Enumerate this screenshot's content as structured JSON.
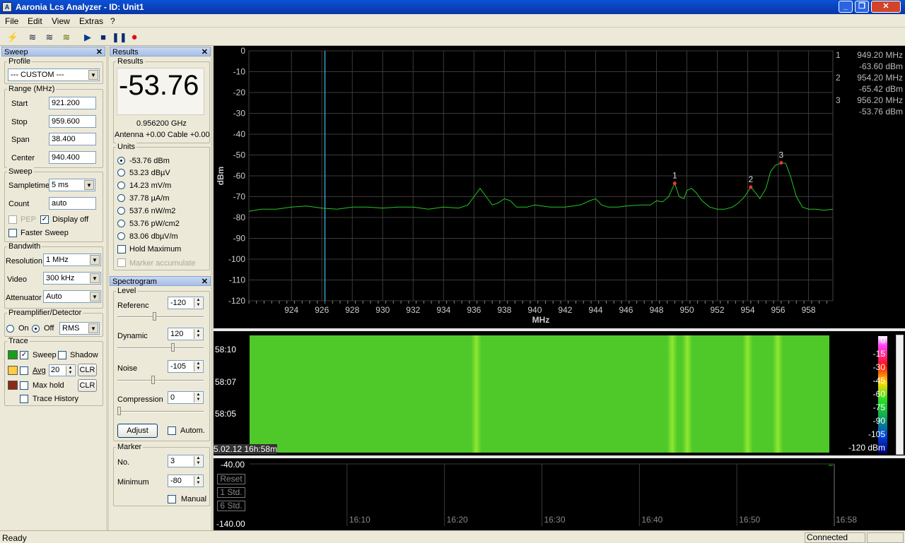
{
  "window": {
    "title": "Aaronia Lcs Analyzer - ID: Unit1"
  },
  "menu": [
    "File",
    "Edit",
    "View",
    "Extras",
    "?"
  ],
  "sweep_panel": {
    "title": "Sweep",
    "profile_label": "Profile",
    "profile_value": "--- CUSTOM ---",
    "range_label": "Range (MHz)",
    "start_label": "Start",
    "start_value": "921.200",
    "stop_label": "Stop",
    "stop_value": "959.600",
    "span_label": "Span",
    "span_value": "38.400",
    "center_label": "Center",
    "center_value": "940.400",
    "sweep_label": "Sweep",
    "sampletime_label": "Sampletime",
    "sampletime_value": "5 ms",
    "count_label": "Count",
    "count_value": "auto",
    "pep_label": "PEP",
    "display_off_label": "Display off",
    "faster_sweep_label": "Faster Sweep",
    "bandwidth_label": "Bandwith",
    "resolution_label": "Resolution",
    "resolution_value": "1 MHz",
    "video_label": "Video",
    "video_value": "300 kHz",
    "attenuator_label": "Attenuator",
    "attenuator_value": "Auto",
    "preamp_label": "Preamplifier/Detector",
    "on_label": "On",
    "off_label": "Off",
    "detector_value": "RMS",
    "trace_label": "Trace",
    "sweep_trace_label": "Sweep",
    "shadow_label": "Shadow",
    "avg_label": "Avg",
    "avg_value": "20",
    "clr_label": "CLR",
    "maxhold_label": "Max hold",
    "clr2_label": "CLR",
    "trace_history_label": "Trace History",
    "colors": {
      "sweep": "#1a9e1a",
      "avg": "#ffcc44",
      "maxhold": "#8b2a14"
    }
  },
  "results_panel": {
    "title": "Results",
    "group_label": "Results",
    "big_value": "-53.76",
    "frequency": "0.956200 GHz",
    "antenna": "Antenna +0.00 Cable +0.00",
    "units_label": "Units",
    "units": [
      "-53.76 dBm",
      "53.23 dBµV",
      "14.23 mV/m",
      "37.78 µA/m",
      "537.6 nW/m2",
      "53.76 pW/cm2",
      "83.06 dbµV/m"
    ],
    "hold_max_label": "Hold Maximum",
    "marker_acc_label": "Marker accumulate"
  },
  "spectrogram_panel": {
    "title": "Spectrogram",
    "level_label": "Level",
    "reference_label": "Referenc",
    "reference_value": "-120",
    "dynamic_label": "Dynamic",
    "dynamic_value": "120",
    "noise_label": "Noise",
    "noise_value": "-105",
    "compression_label": "Compression",
    "compression_value": "0",
    "adjust_label": "Adjust",
    "autom_label": "Autom.",
    "marker_label": "Marker",
    "no_label": "No.",
    "no_value": "3",
    "minimum_label": "Minimum",
    "minimum_value": "-80",
    "manual_label": "Manual"
  },
  "markers": [
    {
      "num": "1",
      "freq": "949.20 MHz",
      "level": "-63.60 dBm"
    },
    {
      "num": "2",
      "freq": "954.20 MHz",
      "level": "-65.42 dBm"
    },
    {
      "num": "3",
      "freq": "956.20 MHz",
      "level": "-53.76 dBm"
    }
  ],
  "chart_data": [
    {
      "type": "line",
      "ylabel": "dBm",
      "xlabel": "MHz",
      "xlim": [
        921.2,
        959.6
      ],
      "ylim": [
        -120,
        0
      ],
      "y_ticks": [
        0,
        -10,
        -20,
        -30,
        -40,
        -50,
        -60,
        -70,
        -80,
        -90,
        -100,
        -110,
        -120
      ],
      "x_ticks": [
        924,
        926,
        928,
        930,
        932,
        934,
        936,
        938,
        940,
        942,
        944,
        946,
        948,
        950,
        952,
        954,
        956,
        958
      ],
      "grid": true,
      "series": [
        {
          "color": "#22c822",
          "x": [
            921.2,
            922,
            923,
            924,
            925,
            926,
            927,
            928,
            929,
            930,
            931,
            932,
            933,
            934,
            935,
            935.6,
            936,
            936.4,
            936.8,
            937.2,
            937.6,
            938,
            938.4,
            938.8,
            939.5,
            940,
            941,
            942,
            943,
            943.6,
            944,
            944.4,
            944.8,
            945.5,
            946,
            947,
            947.6,
            948,
            948.4,
            948.8,
            949.2,
            949.5,
            949.8,
            950,
            950.3,
            950.6,
            951,
            951.5,
            952,
            952.5,
            953,
            953.4,
            953.8,
            954.2,
            954.5,
            954.8,
            955.2,
            955.5,
            955.8,
            956.2,
            956.5,
            956.8,
            957.2,
            957.6,
            958,
            958.5,
            959,
            959.6
          ],
          "y": [
            -77,
            -76,
            -76,
            -75,
            -74.5,
            -75.5,
            -76,
            -75,
            -75,
            -75.5,
            -75,
            -75,
            -76,
            -75,
            -75.5,
            -74,
            -70,
            -66,
            -70,
            -74,
            -73,
            -71,
            -72,
            -75,
            -75,
            -74,
            -75,
            -75,
            -74,
            -72,
            -71,
            -74,
            -75,
            -75,
            -74.5,
            -74,
            -74,
            -72,
            -72.5,
            -70,
            -63.6,
            -70,
            -71,
            -67,
            -66,
            -68,
            -72,
            -75,
            -76,
            -76,
            -75,
            -73,
            -70,
            -65.4,
            -68,
            -71,
            -66,
            -58,
            -55,
            -53.76,
            -54,
            -60,
            -70,
            -75,
            -76,
            -76,
            -76.5,
            -76
          ]
        }
      ],
      "markers": [
        {
          "label": "1",
          "x": 949.2,
          "y": -63.6
        },
        {
          "label": "2",
          "x": 954.2,
          "y": -65.42
        },
        {
          "label": "3",
          "x": 956.2,
          "y": -53.76
        }
      ]
    },
    {
      "type": "heatmap",
      "y_tick_labels": [
        "58:10",
        "58:07",
        "58:05"
      ],
      "timestamp": "5.02.12 16h:58m",
      "scale_ticks": [
        "0",
        "-15",
        "-30",
        "-45",
        "-60",
        "-75",
        "-90",
        "-105",
        "-120 dBm"
      ],
      "bright_bands_mhz": [
        936.2,
        949.2,
        950.2,
        954.2,
        956.2
      ]
    },
    {
      "type": "line",
      "y_tick_labels": [
        "-40.00",
        "-140.00"
      ],
      "x_tick_labels": [
        "16:10",
        "16:20",
        "16:30",
        "16:40",
        "16:50",
        "16:58"
      ],
      "buttons": [
        "Reset",
        "1 Std.",
        "6 Std."
      ]
    }
  ],
  "status": {
    "left": "Ready",
    "right": "Connected"
  }
}
